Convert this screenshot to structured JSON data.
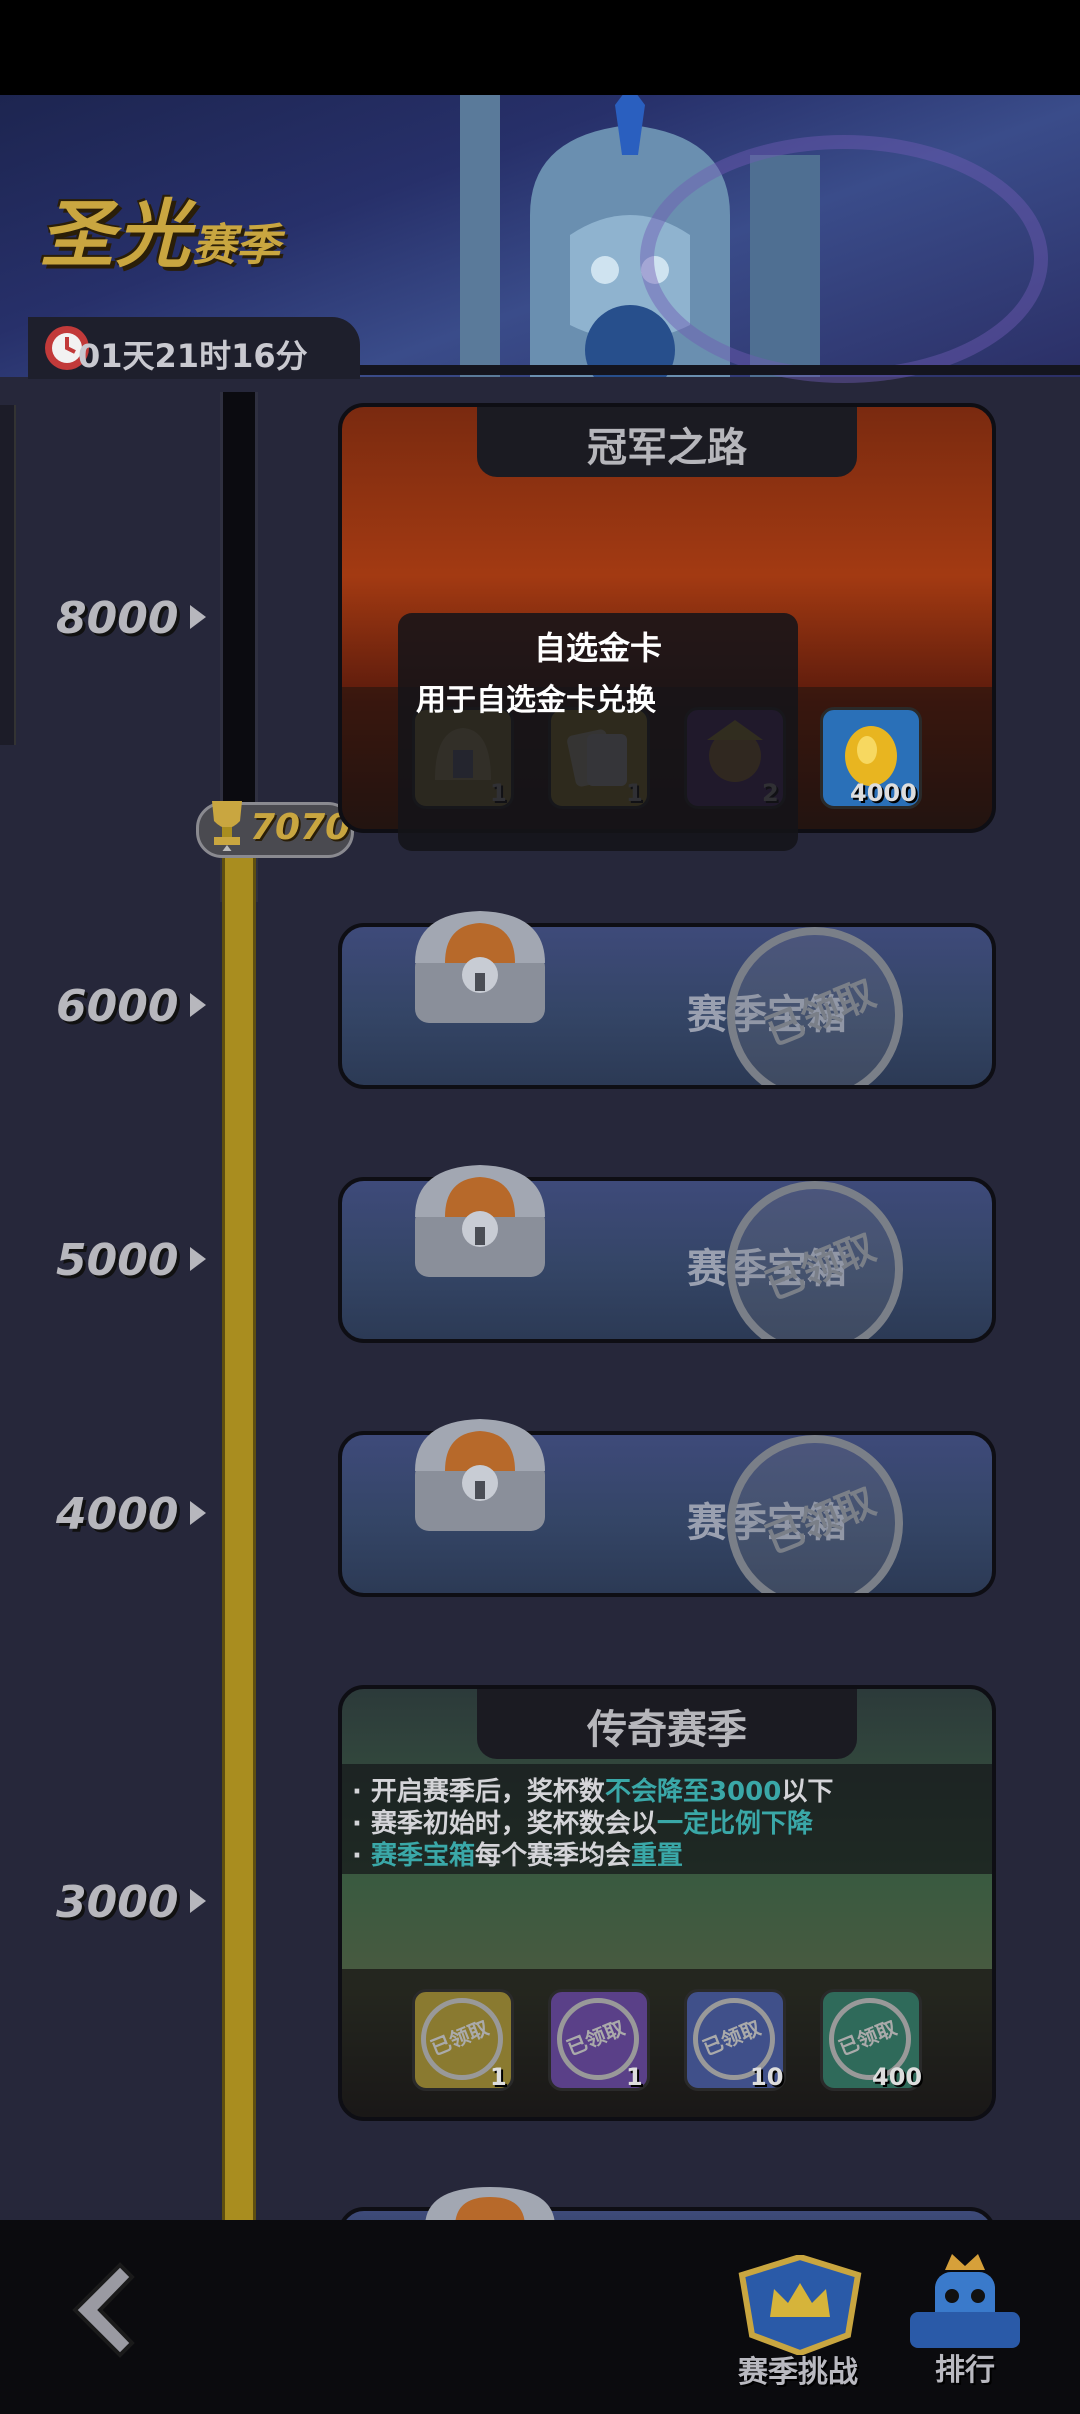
{
  "season": {
    "title_main": "圣光",
    "title_sub": "赛季",
    "timer": "01天21时16分"
  },
  "progress": {
    "current_trophies": "7070",
    "current_trophies_value": 7070,
    "ticks": [
      "8000",
      "6000",
      "5000",
      "4000",
      "3000"
    ]
  },
  "cards": {
    "champion_road": {
      "title": "冠军之路",
      "rewards": [
        {
          "icon": "helmet-icon",
          "count": "1"
        },
        {
          "icon": "card-icon",
          "count": "1"
        },
        {
          "icon": "hero-portrait-icon",
          "count": "2"
        },
        {
          "icon": "gold-coin-icon",
          "count": "4000"
        }
      ]
    },
    "chests": [
      {
        "threshold": "6000",
        "label": "赛季宝箱",
        "status": "已领取"
      },
      {
        "threshold": "5000",
        "label": "赛季宝箱",
        "status": "已领取"
      },
      {
        "threshold": "4000",
        "label": "赛季宝箱",
        "status": "已领取"
      }
    ],
    "legend_season": {
      "title": "传奇赛季",
      "info": [
        {
          "a": "· 开启赛季后，奖杯数",
          "b": "不会降至3000",
          "c": "以下"
        },
        {
          "a": "· 赛季初始时，奖杯数会以",
          "b": "一定比例下降",
          "c": ""
        },
        {
          "a": "· ",
          "b": "赛季宝箱",
          "c": "每个赛季均会",
          "d": "重置"
        }
      ],
      "rewards": [
        {
          "count": "1",
          "status": "已领取"
        },
        {
          "count": "1",
          "status": "已领取"
        },
        {
          "count": "10",
          "status": "已领取"
        },
        {
          "count": "400",
          "status": "已领取"
        }
      ]
    }
  },
  "tooltip": {
    "title": "自选金卡",
    "description": "用于自选金卡兑换"
  },
  "bottom_nav": {
    "season_challenge": "赛季挑战",
    "ranking": "排行"
  },
  "colors": {
    "gold": "#c9a640",
    "teal_highlight": "#3aa8a8",
    "track_gold": "#a98d1f"
  }
}
